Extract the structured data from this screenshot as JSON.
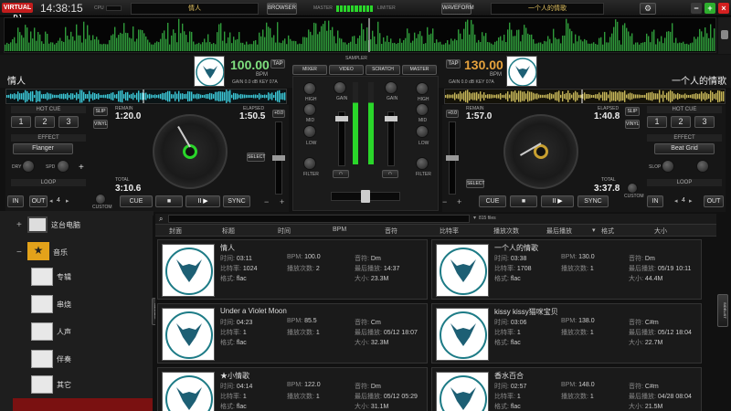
{
  "app": {
    "logo": "VIRTUAL DJ",
    "clock": "14:38:15",
    "cpu_label": "CPU",
    "master_label": "MASTER",
    "limiter_label": "LIMITER"
  },
  "header": {
    "deck1_title": "情人",
    "deck2_title": "一个人的情歌",
    "browser_btn": "BROWSER",
    "waveform_btn": "WAVEFORM"
  },
  "window": {
    "minimize": "−",
    "maximize": "+",
    "close": "×"
  },
  "deck1": {
    "title": "情人",
    "bpm": "100.00",
    "bpm_unit": "BPM",
    "tap": "TAP",
    "gain": "GAIN",
    "gain_val": "0.0",
    "gain_unit": "dB",
    "key_label": "KEY",
    "key": "07A",
    "remain_label": "REMAIN",
    "remain": "1:20.0",
    "elapsed_label": "ELAPSED",
    "elapsed": "1:50.5",
    "total_label": "TOTAL",
    "total": "3:10.6",
    "hotcue_label": "HOT CUE",
    "hotcues": [
      "1",
      "2",
      "3"
    ],
    "slip": "SLIP",
    "vinyl": "VINYL",
    "effect_label": "EFFECT",
    "effect": "Flanger",
    "effect_knob1": "DRY",
    "effect_knob2": "SPD",
    "loop_label": "LOOP",
    "loop_in": "IN",
    "loop_out": "OUT",
    "loop_size": "4",
    "custom": "CUSTOM",
    "pitch": "+0.0",
    "select": "SELECT",
    "cue": "CUE",
    "stop": "■",
    "play": "II ▶",
    "sync": "SYNC"
  },
  "deck2": {
    "title": "一个人的情歌",
    "bpm": "130.00",
    "bpm_unit": "BPM",
    "tap": "TAP",
    "gain": "GAIN",
    "gain_val": "0.0",
    "gain_unit": "dB",
    "key_label": "KEY",
    "key": "07A",
    "remain_label": "REMAIN",
    "remain": "1:57.0",
    "elapsed_label": "ELAPSED",
    "elapsed": "1:40.8",
    "total_label": "TOTAL",
    "total": "3:37.8",
    "hotcue_label": "HOT CUE",
    "hotcues": [
      "1",
      "2",
      "3"
    ],
    "slip": "SLIP",
    "vinyl": "VINYL",
    "effect_label": "EFFECT",
    "effect": "Beat Grid",
    "effect_knob1": "SLOP",
    "loop_label": "LOOP",
    "loop_in": "IN",
    "loop_out": "OUT",
    "loop_size": "4",
    "custom": "CUSTOM",
    "pitch": "+0.0",
    "select": "SELECT",
    "cue": "CUE",
    "stop": "■",
    "play": "II ▶",
    "sync": "SYNC"
  },
  "mixer": {
    "tabs": [
      "MIXER",
      "VIDEO",
      "SCRATCH",
      "MASTER"
    ],
    "sampler": "SAMPLER",
    "gain": "GAIN",
    "high": "HIGH",
    "mid": "MID",
    "low": "LOW",
    "filter": "FILTER"
  },
  "browser": {
    "search_count": "815 files",
    "columns": [
      "封面",
      "标题",
      "时间",
      "BPM",
      "音符",
      "比特率",
      "播放次数",
      "最后播放",
      "格式",
      "大小"
    ],
    "tree": [
      {
        "label": "这台电脑",
        "icon": "computer-icon"
      },
      {
        "label": "音乐",
        "icon": "star-folder-icon"
      },
      {
        "label": "专辑"
      },
      {
        "label": "串烧"
      },
      {
        "label": "人声"
      },
      {
        "label": "伴奏"
      },
      {
        "label": "其它"
      }
    ],
    "field_labels": {
      "time": "时间:",
      "bpm": "BPM:",
      "key": "音符:",
      "bitrate": "比特率:",
      "plays": "播放次数:",
      "last": "最后播放:",
      "format": "格式:",
      "size": "大小:"
    },
    "cards": [
      {
        "title": "情人",
        "time": "03:11",
        "bpm": "100.0",
        "key": "Dm",
        "bitrate": "1024",
        "plays": "2",
        "last": "14:37",
        "format": "flac",
        "size": "23.3M"
      },
      {
        "title": "一个人的情歌",
        "time": "03:38",
        "bpm": "130.0",
        "key": "Dm",
        "bitrate": "1708",
        "plays": "1",
        "last": "05/19 10:11",
        "format": "flac",
        "size": "44.4M"
      },
      {
        "title": "Under a Violet Moon",
        "time": "04:23",
        "bpm": "85.5",
        "key": "Cm",
        "bitrate": "1",
        "plays": "1",
        "last": "05/12 18:07",
        "format": "flac",
        "size": "32.3M"
      },
      {
        "title": "kissy kissy猫咪宝贝",
        "time": "03:06",
        "bpm": "138.0",
        "key": "C#m",
        "bitrate": "1",
        "plays": "1",
        "last": "05/12 18:04",
        "format": "flac",
        "size": "22.7M"
      },
      {
        "title": "★小情歌",
        "time": "04:14",
        "bpm": "122.0",
        "key": "Dm",
        "bitrate": "1",
        "plays": "1",
        "last": "05/12 05:29",
        "format": "flac",
        "size": "31.1M"
      },
      {
        "title": "香水百合",
        "time": "02:57",
        "bpm": "148.0",
        "key": "C#m",
        "bitrate": "1",
        "plays": "1",
        "last": "04/28 08:04",
        "format": "flac",
        "size": "21.5M"
      }
    ],
    "side_tab_left": "SIDEBAR",
    "side_tab_right": "SIDELIST"
  },
  "colors": {
    "accent_red": "#c31d1d",
    "wave_green": "#2ad62a",
    "deck1_wave": "#3cc9d8",
    "deck2_wave": "#c8b85a",
    "bpm2": "#e6a23c"
  }
}
